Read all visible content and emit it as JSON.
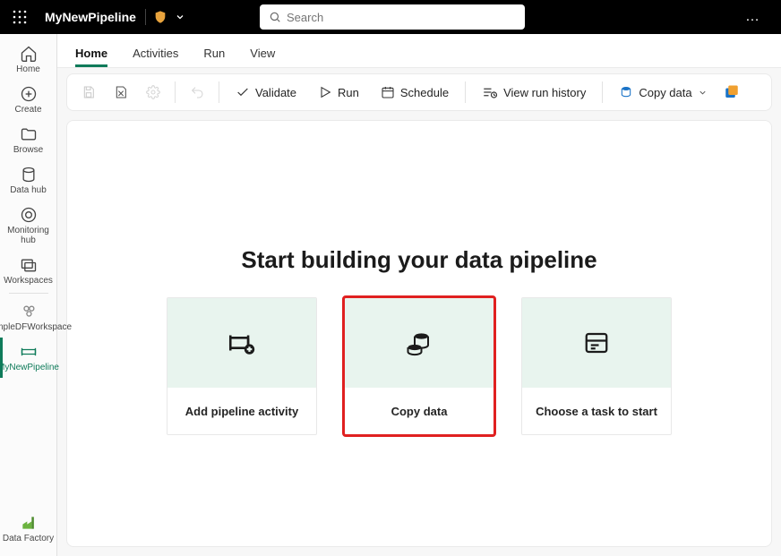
{
  "topbar": {
    "title": "MyNewPipeline",
    "search_placeholder": "Search"
  },
  "rail": {
    "home": "Home",
    "create": "Create",
    "browse": "Browse",
    "datahub": "Data hub",
    "monitoring": "Monitoring hub",
    "workspaces": "Workspaces",
    "sampledfw": "SampleDFWorkspace",
    "mynewpipeline": "MyNewPipeline",
    "datafactory": "Data Factory"
  },
  "tabs": {
    "home": "Home",
    "activities": "Activities",
    "run": "Run",
    "view": "View"
  },
  "toolbar": {
    "validate": "Validate",
    "run": "Run",
    "schedule": "Schedule",
    "view_run_history": "View run history",
    "copy_data": "Copy data"
  },
  "canvas": {
    "heading": "Start building your data pipeline",
    "cards": {
      "add_activity": "Add pipeline activity",
      "copy_data": "Copy data",
      "choose_task": "Choose a task to start"
    }
  }
}
